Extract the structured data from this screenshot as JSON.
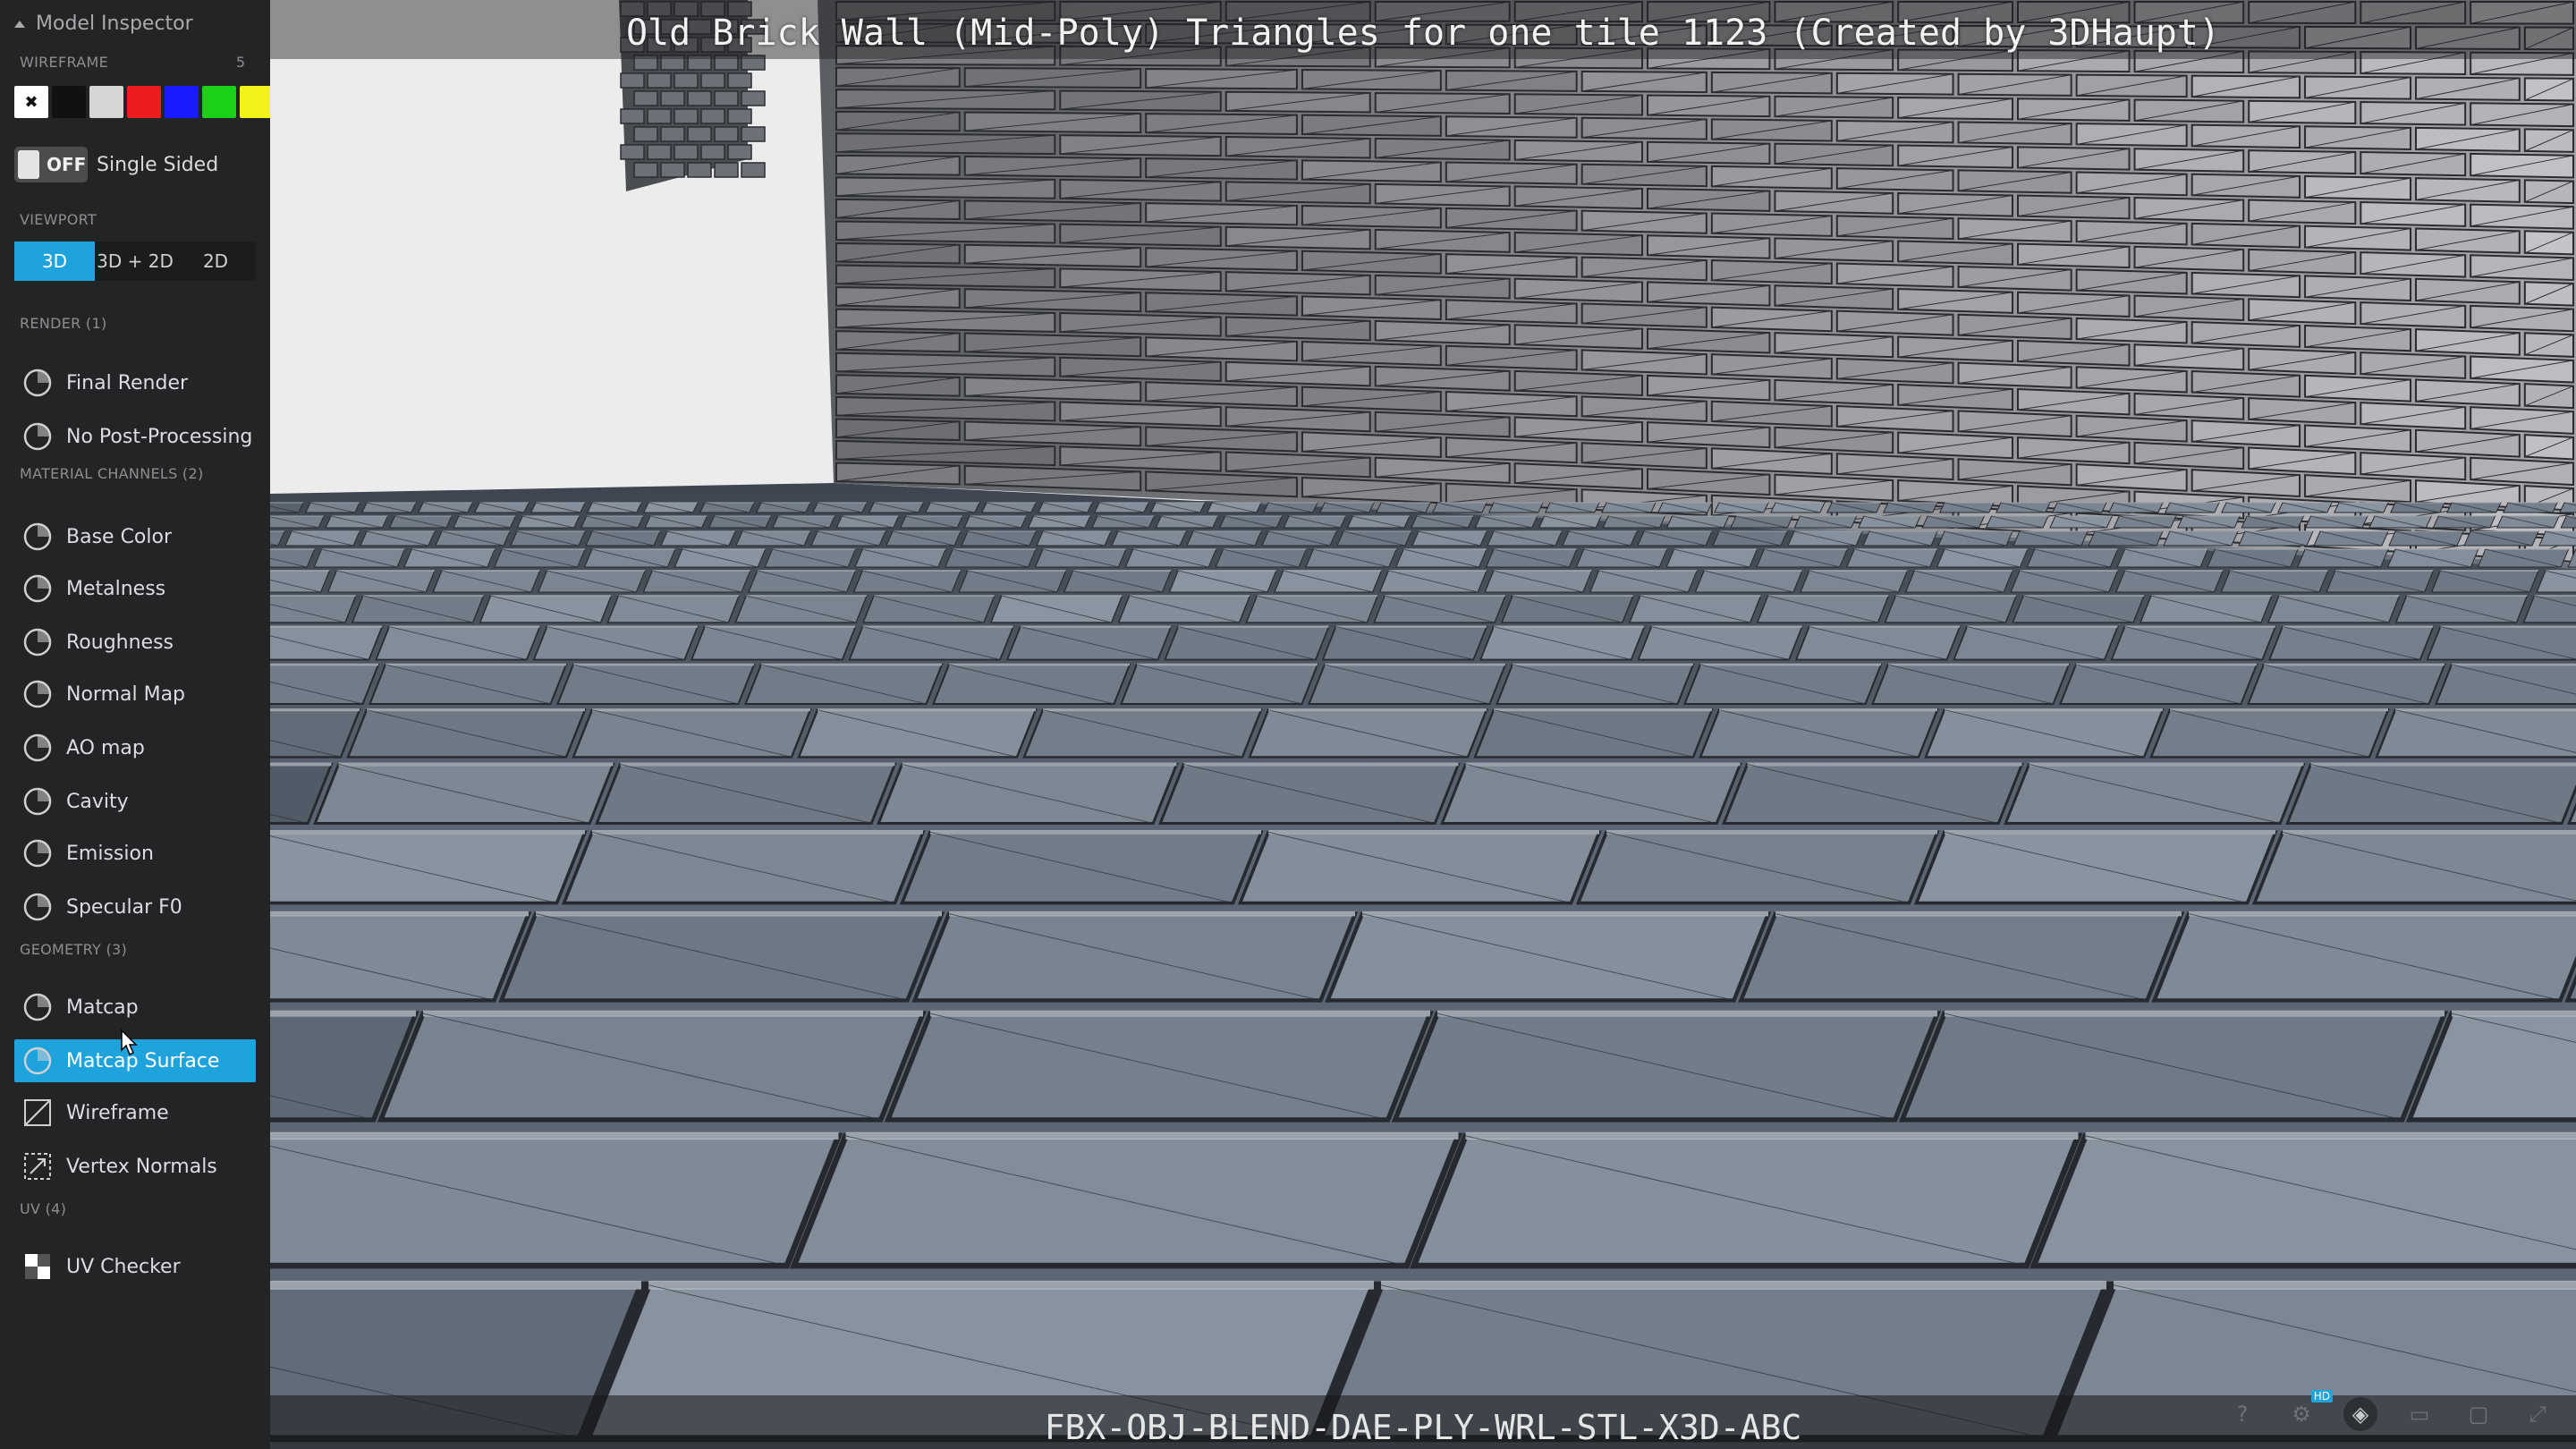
{
  "panel": {
    "title": "Model Inspector"
  },
  "wireframe": {
    "label": "WIREFRAME",
    "count": "5",
    "swatches": [
      {
        "name": "white",
        "color": "#ffffff",
        "selected": true
      },
      {
        "name": "black",
        "color": "#111111"
      },
      {
        "name": "gray",
        "color": "#d6d6d6"
      },
      {
        "name": "red",
        "color": "#ee1c1c"
      },
      {
        "name": "blue",
        "color": "#1a1aff"
      },
      {
        "name": "green",
        "color": "#1ad11a"
      },
      {
        "name": "yellow",
        "color": "#f3f31a"
      }
    ]
  },
  "single_sided": {
    "state": "OFF",
    "label": "Single Sided"
  },
  "viewport": {
    "label": "VIEWPORT",
    "options": [
      "3D",
      "3D + 2D",
      "2D"
    ],
    "active": "3D"
  },
  "render": {
    "label": "RENDER (1)",
    "items": [
      {
        "label": "Final Render",
        "icon": "final-render-icon"
      },
      {
        "label": "No Post-Processing",
        "icon": "no-post-processing-icon"
      }
    ]
  },
  "material": {
    "label": "MATERIAL CHANNELS (2)",
    "items": [
      {
        "label": "Base Color",
        "icon": "base-color-icon"
      },
      {
        "label": "Metalness",
        "icon": "metalness-icon"
      },
      {
        "label": "Roughness",
        "icon": "roughness-icon"
      },
      {
        "label": "Normal Map",
        "icon": "normal-map-icon"
      },
      {
        "label": "AO map",
        "icon": "ao-map-icon"
      },
      {
        "label": "Cavity",
        "icon": "cavity-icon"
      },
      {
        "label": "Emission",
        "icon": "emission-icon"
      },
      {
        "label": "Specular F0",
        "icon": "specular-icon"
      }
    ]
  },
  "geometry": {
    "label": "GEOMETRY (3)",
    "items": [
      {
        "label": "Matcap",
        "icon": "matcap-icon"
      },
      {
        "label": "Matcap Surface",
        "icon": "matcap-surface-icon",
        "active": true
      },
      {
        "label": "Wireframe",
        "icon": "wireframe-icon"
      },
      {
        "label": "Vertex Normals",
        "icon": "vertex-normals-icon"
      }
    ]
  },
  "uv": {
    "label": "UV (4)",
    "items": [
      {
        "label": "UV Checker",
        "icon": "uv-checker-icon"
      }
    ]
  },
  "scene": {
    "title": "Old Brick Wall (Mid-Poly)  Triangles for one tile 1123 (Created by 3DHaupt)",
    "formats": "FBX-OBJ-BLEND-DAE-PLY-WRL-STL-X3D-ABC",
    "hd_badge": "HD"
  },
  "colors": {
    "accent": "#1fa3dd",
    "sidebar_bg": "#232426"
  }
}
